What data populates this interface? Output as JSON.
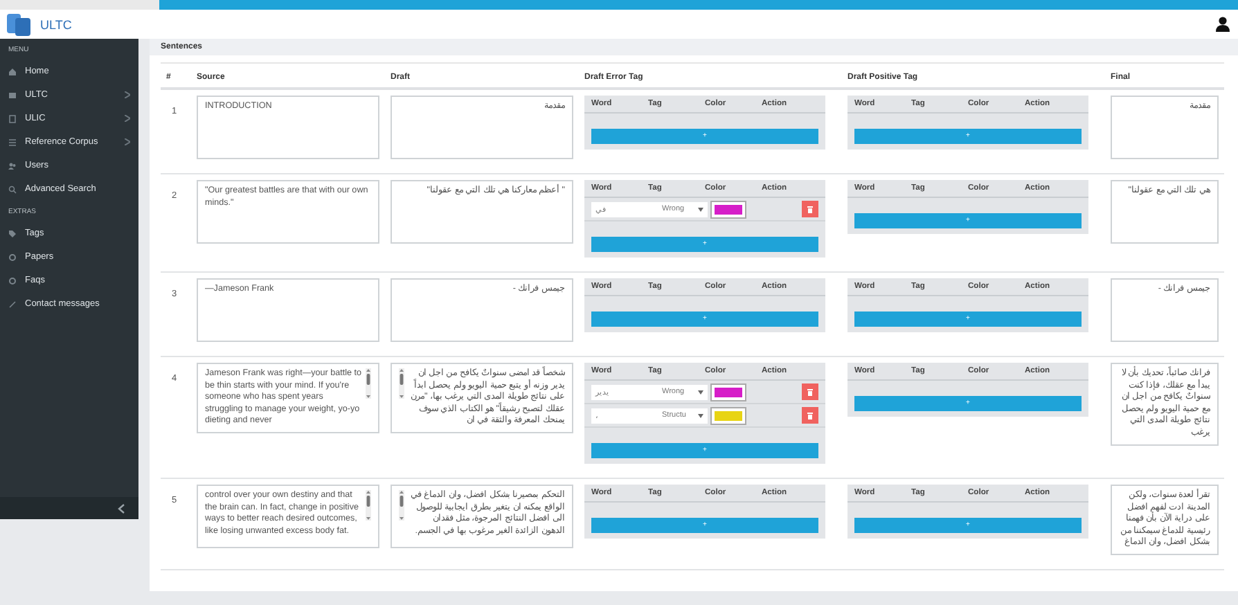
{
  "logo": {
    "text": "ULTC"
  },
  "sidebar": {
    "sections": [
      {
        "title": "MENU",
        "items": [
          {
            "label": "Home",
            "has_submenu": false
          },
          {
            "label": "ULTC",
            "has_submenu": true
          },
          {
            "label": "ULIC",
            "has_submenu": true
          },
          {
            "label": "Reference Corpus",
            "has_submenu": true
          },
          {
            "label": "Users",
            "has_submenu": false
          },
          {
            "label": "Advanced Search",
            "has_submenu": false
          }
        ]
      },
      {
        "title": "EXTRAS",
        "items": [
          {
            "label": "Tags",
            "has_submenu": false
          },
          {
            "label": "Papers",
            "has_submenu": false
          },
          {
            "label": "Faqs",
            "has_submenu": false
          },
          {
            "label": "Contact messages",
            "has_submenu": false
          }
        ]
      }
    ]
  },
  "panel": {
    "title": "Sentences"
  },
  "table": {
    "columns": [
      "#",
      "Source",
      "Draft",
      "Draft Error Tag",
      "Draft Positive Tag",
      "Final"
    ],
    "rows": [
      {
        "number": "1",
        "source": "INTRODUCTION",
        "draft": "مقدمة",
        "has_scrollbar": false,
        "error_tags": {
          "columns": [
            "Word",
            "Tag",
            "Color",
            "Action"
          ],
          "add_label": "+"
        },
        "positive_tags": {
          "columns": [
            "Word",
            "Tag",
            "Color",
            "Action"
          ],
          "add_label": "+"
        },
        "final": "مقدمة"
      },
      {
        "number": "2",
        "source": "\"Our greatest battles are that with our own minds.\"",
        "draft": "\" أعظم معاركنا هي تلك التي مع عقولنا\"",
        "has_scrollbar": false,
        "error_tags": {
          "columns": [
            "Word",
            "Tag",
            "Color",
            "Action"
          ],
          "entries": [
            {
              "word": "في",
              "tag": "Wrong",
              "color": "#d61ec8"
            }
          ],
          "add_label": "+"
        },
        "positive_tags": {
          "columns": [
            "Word",
            "Tag",
            "Color",
            "Action"
          ],
          "add_label": "+"
        },
        "final": "هي تلك التي مع عقولنا\""
      },
      {
        "number": "3",
        "source": "—Jameson Frank",
        "draft": "جيمس فرانك -",
        "has_scrollbar": false,
        "error_tags": {
          "columns": [
            "Word",
            "Tag",
            "Color",
            "Action"
          ],
          "add_label": "+"
        },
        "positive_tags": {
          "columns": [
            "Word",
            "Tag",
            "Color",
            "Action"
          ],
          "add_label": "+"
        },
        "final": "جيمس فرانك -"
      },
      {
        "number": "4",
        "source": "Jameson Frank was right—your battle to be thin starts with your mind. If you're someone who has spent years struggling to manage your weight, yo-yo dieting and never",
        "draft": "شخصاً قد امضى سنواتٌ يكافح من اجل ان يدير وزنه أو يتبع حمية اليويو ولم يحصل ابداً على نتائج طويلة المدى التي يرغب بها، \"مرن عقلك لتصبح رشيقاً\" هو الكتاب الذي سوف يمنحك المعرفة والثقة في ان",
        "has_scrollbar": true,
        "error_tags": {
          "columns": [
            "Word",
            "Tag",
            "Color",
            "Action"
          ],
          "entries": [
            {
              "word": "يدير",
              "tag": "Wrong",
              "color": "#d61ec8"
            },
            {
              "word": "،",
              "tag": "Structu",
              "color": "#e8d414"
            }
          ],
          "add_label": "+"
        },
        "positive_tags": {
          "columns": [
            "Word",
            "Tag",
            "Color",
            "Action"
          ],
          "add_label": "+"
        },
        "final": "فرانك صائباً، تحديك بأن لا يبدأ مع عقلك، فإذا كنت سنواتٌ يكافح من اجل ان مع حمية اليويو ولم يحصل نتائج طويلة المدى التي يرغب"
      },
      {
        "number": "5",
        "source": "control over your own destiny and that the brain can. In fact, change in positive ways to better reach desired outcomes, like losing unwanted excess body fat.",
        "draft": "التحكم بمصيرنا بشكل افضل، وان الدماغ في الواقع يمكنه ان يتغير بطرق ايجابية للوصول الى افضل النتائج المرجوة، مثل فقدان الدهون الزائدة الغير مرغوب بها في الجسم.",
        "has_scrollbar": true,
        "error_tags": {
          "columns": [
            "Word",
            "Tag",
            "Color",
            "Action"
          ],
          "add_label": "+"
        },
        "positive_tags": {
          "columns": [
            "Word",
            "Tag",
            "Color",
            "Action"
          ],
          "add_label": "+"
        },
        "final": "تقرأ لعدة سنوات، ولكن المدينة ادت لفهم افضل على دراية الآن بأن فهمنا رئيسية للدماغ سيمكننا من بشكل افضل، وان الدماغ"
      }
    ]
  }
}
